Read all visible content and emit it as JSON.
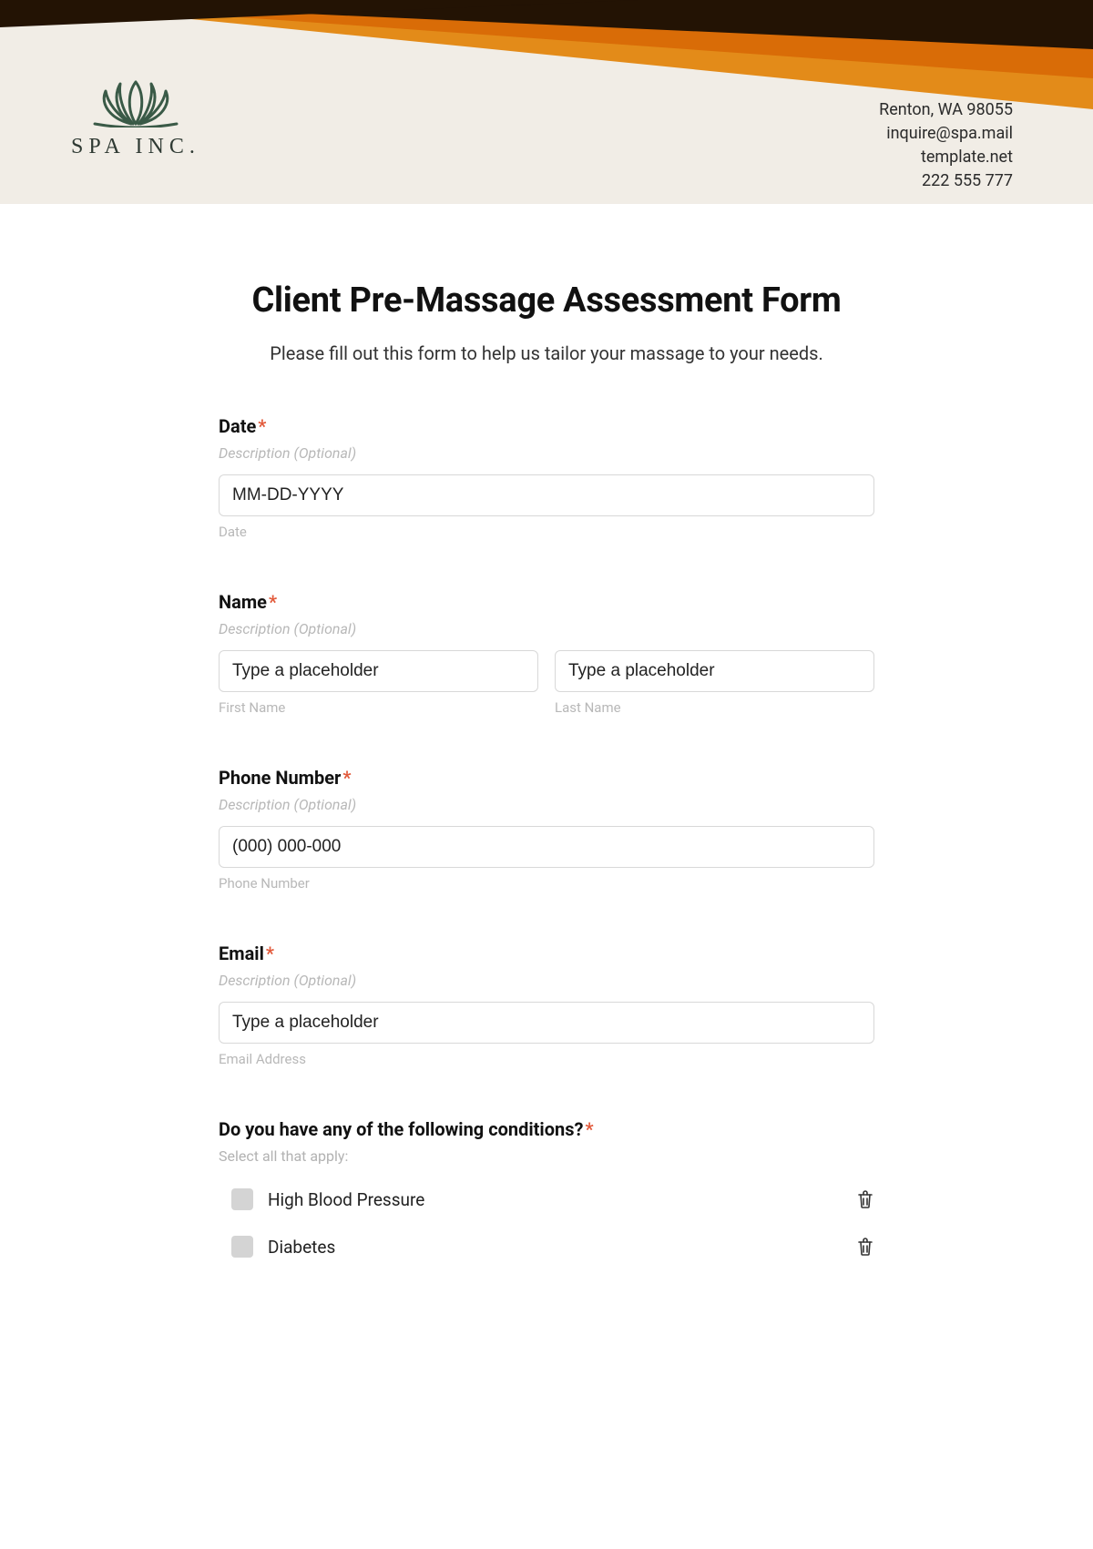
{
  "header": {
    "brand": "SPA INC.",
    "contact": {
      "address": "Renton, WA 98055",
      "email": "inquire@spa.mail",
      "website": "template.net",
      "phone": "222 555 777"
    }
  },
  "form": {
    "title": "Client Pre-Massage Assessment Form",
    "subtitle": "Please fill out this form to help us tailor your massage to your needs.",
    "description_placeholder": "Description (Optional)",
    "fields": {
      "date": {
        "label": "Date",
        "placeholder": "MM-DD-YYYY",
        "sublabel": "Date"
      },
      "name": {
        "label": "Name",
        "first_placeholder": "Type a placeholder",
        "last_placeholder": "Type a placeholder",
        "first_sublabel": "First Name",
        "last_sublabel": "Last Name"
      },
      "phone": {
        "label": "Phone Number",
        "placeholder": "(000) 000-000",
        "sublabel": "Phone Number"
      },
      "email": {
        "label": "Email",
        "placeholder": "Type a placeholder",
        "sublabel": "Email Address"
      },
      "conditions": {
        "label": "Do you have any of the following conditions?",
        "helper": "Select all that apply:",
        "options": [
          "High Blood Pressure",
          "Diabetes"
        ]
      }
    }
  }
}
